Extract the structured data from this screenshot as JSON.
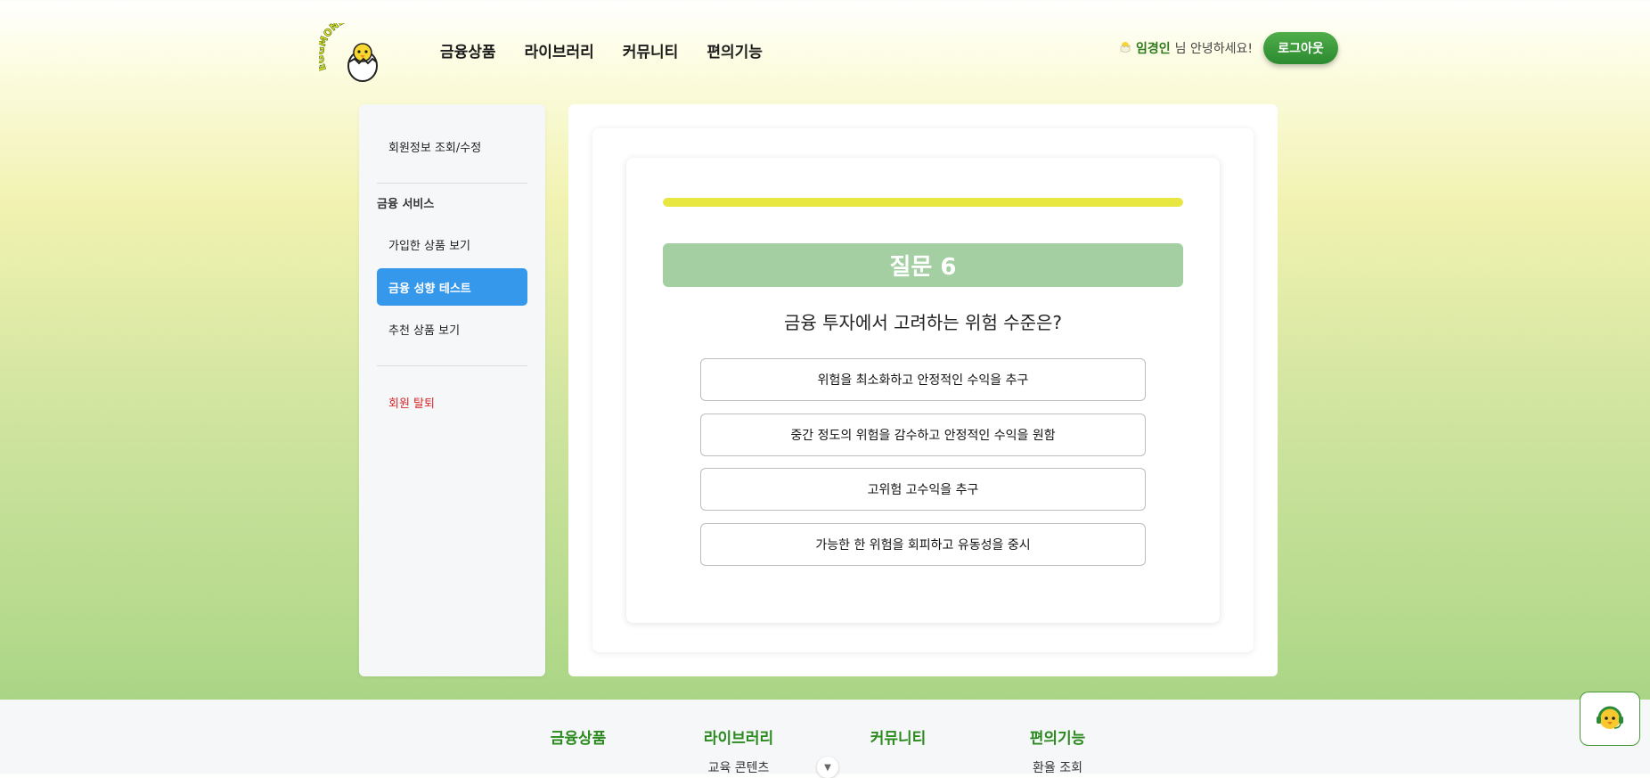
{
  "header": {
    "logo_text": "EGGMONEYNA",
    "nav": [
      "금융상품",
      "라이브러리",
      "커뮤니티",
      "편의기능"
    ],
    "user_name": "임경인",
    "greeting_suffix": "님 안녕하세요!",
    "logout_label": "로그아웃"
  },
  "sidebar": {
    "profile_item": "회원정보 조회/수정",
    "section_heading": "금융 서비스",
    "items": [
      "가입한 상품 보기",
      "금융 성향 테스트",
      "추천 상품 보기"
    ],
    "active_item": "금융 성향 테스트",
    "withdraw_item": "회원 탈퇴"
  },
  "quiz": {
    "progress": 1.0,
    "question_title": "질문 6",
    "question_text": "금융 투자에서 고려하는 위험 수준은?",
    "answers": [
      "위험을 최소화하고 안정적인 수익을 추구",
      "중간 정도의 위험을 감수하고 안정적인 수익을 원함",
      "고위험 고수익을 추구",
      "가능한 한 위험을 회피하고 유동성을 중시"
    ]
  },
  "footer": {
    "columns": [
      "금융상품",
      "라이브러리",
      "커뮤니티",
      "편의기능"
    ],
    "library_link": "교육 콘텐츠",
    "convenience_link": "환율 조회"
  },
  "colors": {
    "accent_green": "#2c8a30",
    "active_blue": "#3598ea",
    "progress_yellow": "#e8e641",
    "question_header": "#a3cfa3",
    "danger_red": "#d42a2a"
  },
  "icons": {
    "user": "chick-egg-icon",
    "chatbot": "headset-chick-icon",
    "scroll": "chevron-down-icon"
  }
}
